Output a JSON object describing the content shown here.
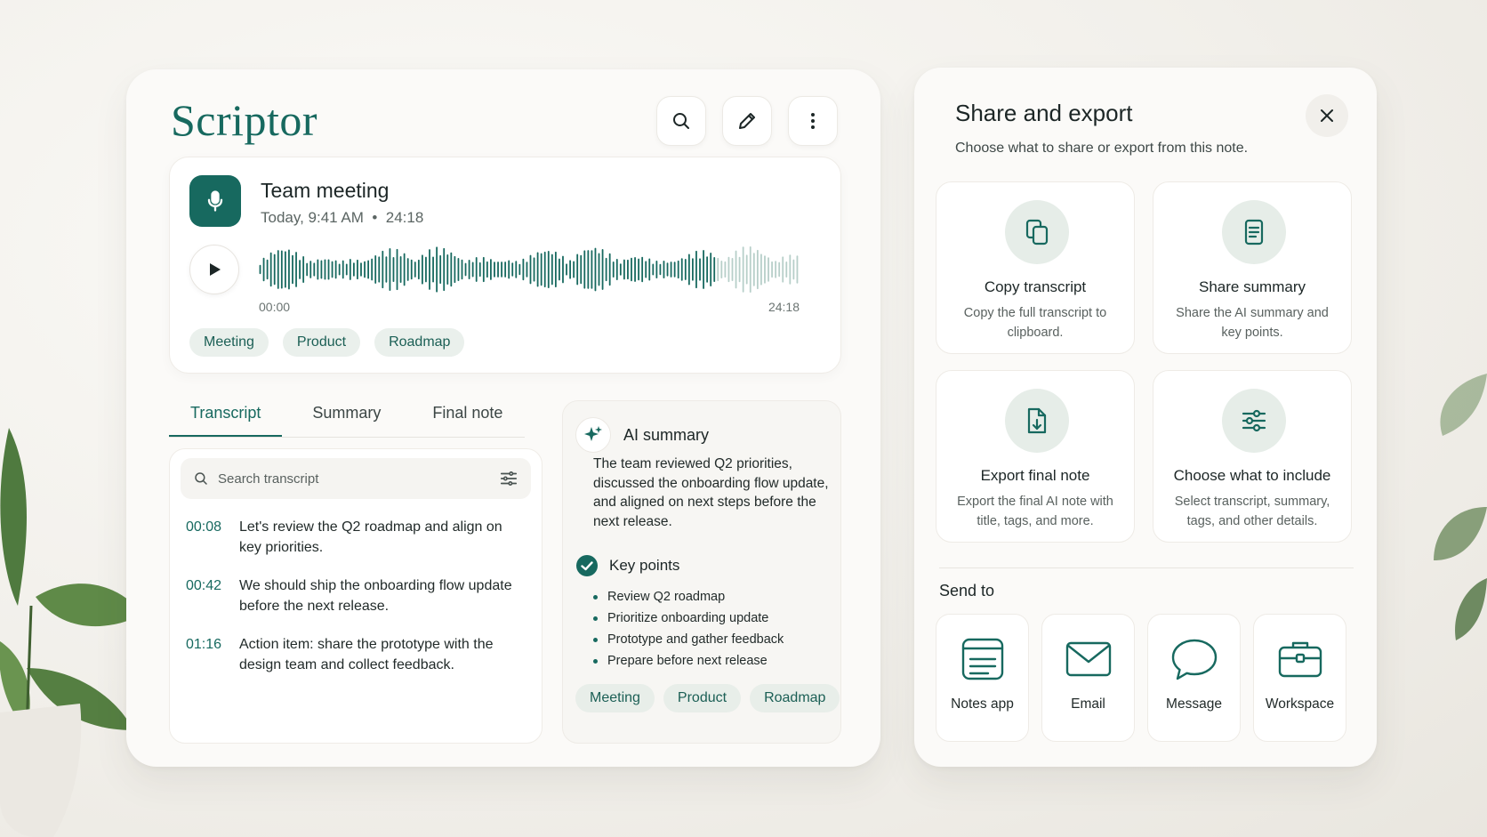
{
  "app": {
    "name": "Scriptor",
    "icons": [
      "search-icon",
      "pencil-icon",
      "more-vertical-icon"
    ]
  },
  "recording": {
    "title": "Team meeting",
    "meta": "Today, 9:41 AM  •  24:18",
    "time_start": "00:00",
    "time_end": "24:18",
    "played_fraction": 0.84,
    "tags": [
      "Meeting",
      "Product",
      "Roadmap"
    ]
  },
  "tabs": [
    {
      "label": "Transcript",
      "active": true
    },
    {
      "label": "Summary",
      "active": false
    },
    {
      "label": "Final note",
      "active": false
    }
  ],
  "transcript": {
    "search_placeholder": "Search transcript",
    "lines": [
      {
        "time": "00:08",
        "text": "Let's review the Q2 roadmap and align on key priorities."
      },
      {
        "time": "00:42",
        "text": "We should ship the onboarding flow update before the next release."
      },
      {
        "time": "01:16",
        "text": "Action item: share the prototype with the design team and collect feedback."
      }
    ]
  },
  "ai_summary": {
    "title": "AI summary",
    "body": "The team reviewed Q2 priorities, discussed the onboarding flow update, and aligned on next steps before the next release.",
    "key_points_title": "Key points",
    "key_points": [
      "Review Q2 roadmap",
      "Prioritize onboarding update",
      "Prototype and gather feedback",
      "Prepare before next release"
    ],
    "tags": [
      "Meeting",
      "Product",
      "Roadmap"
    ]
  },
  "share": {
    "title": "Share and export",
    "subtitle": "Choose what to share or export from this note.",
    "options": [
      {
        "title": "Copy transcript",
        "desc": "Copy the full transcript to clipboard.",
        "icon": "copy-icon"
      },
      {
        "title": "Share summary",
        "desc": "Share the AI summary and key points.",
        "icon": "document-icon"
      },
      {
        "title": "Export final note",
        "desc": "Export the final AI note with title, tags, and more.",
        "icon": "file-export-icon"
      },
      {
        "title": "Choose what to include",
        "desc": "Select transcript, summary, tags, and other details.",
        "icon": "sliders-icon"
      }
    ],
    "send_to_label": "Send to",
    "send_to": [
      {
        "label": "Notes app",
        "icon": "notes-icon"
      },
      {
        "label": "Email",
        "icon": "mail-icon"
      },
      {
        "label": "Message",
        "icon": "chat-bubble-icon"
      },
      {
        "label": "Workspace",
        "icon": "briefcase-icon"
      }
    ]
  },
  "colors": {
    "accent": "#17695f",
    "tag_bg": "#eaf0ec",
    "card_bg": "#fbfaf8"
  }
}
